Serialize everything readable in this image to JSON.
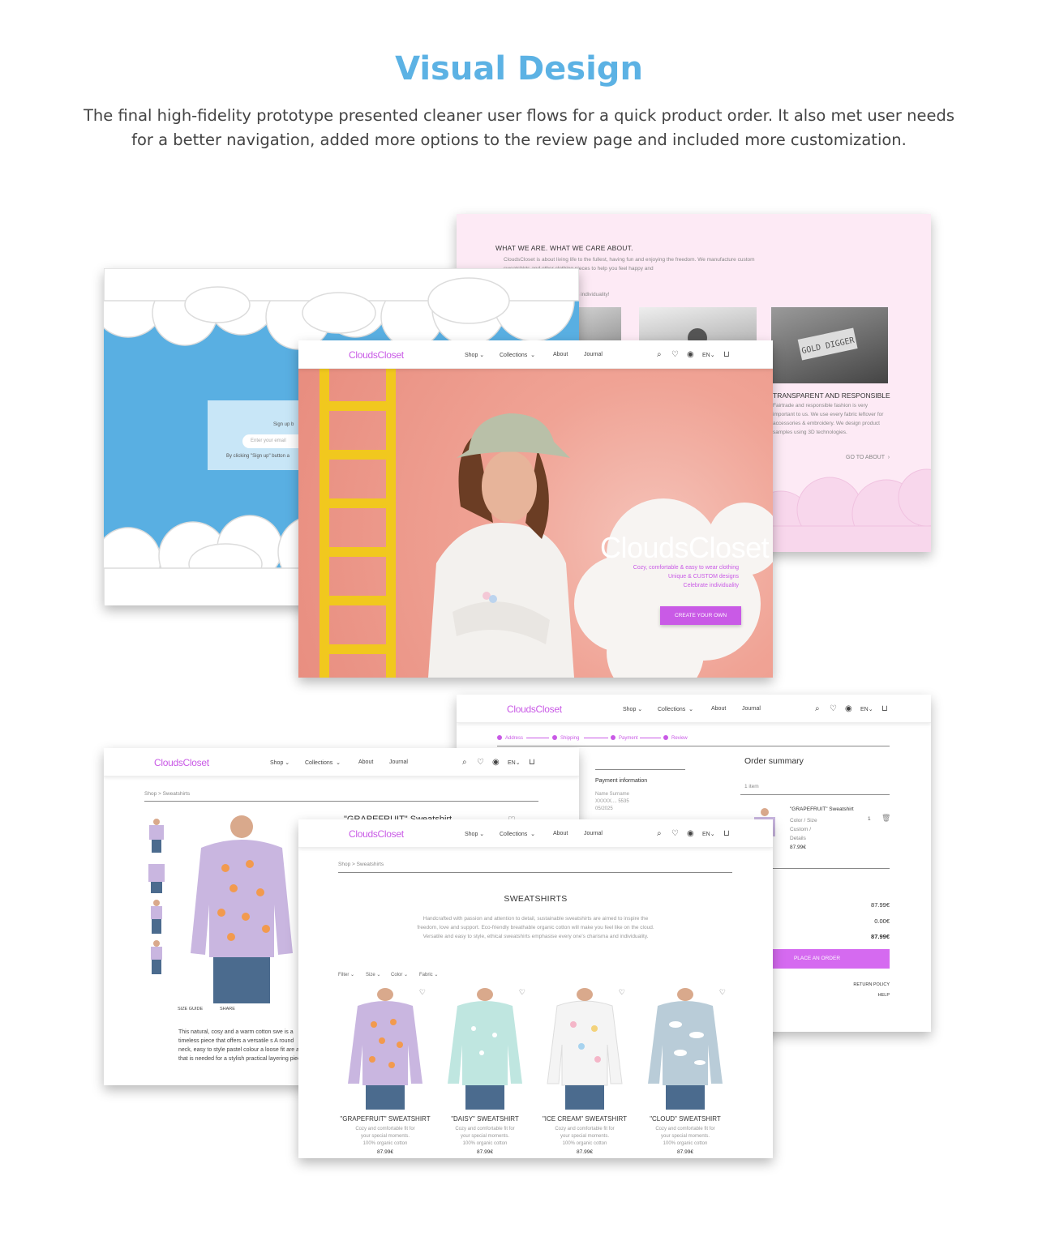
{
  "heading": "Visual Design",
  "intro": "The final high-fidelity prototype presented cleaner user flows for a quick product order. It also met user needs for a better navigation, added more options to the review page and included more customization.",
  "header": {
    "logo": "CloudsCloset",
    "nav": [
      "Shop",
      "Collections",
      "About",
      "Journal"
    ],
    "lang": "EN"
  },
  "about": {
    "title": "WHAT WE ARE.  WHAT WE CARE ABOUT.",
    "text1": "CloudsCloset is about living life to the fullest, having fun and enjoying the freedom. We manufacture custom sweatshirts and other clothing pieces to help you feel happy and",
    "text2": "support & celebrate each other's individuality!",
    "title2": "TRANSPARENT AND RESPONSIBLE",
    "text3": "Fairtrade and responsible fashion is very important to us. We use every fabric leftover for accessories & embroidery. We design product samples using 3D technologies.",
    "go": "GO TO ABOUT",
    "badge": "GOLD DIGGER"
  },
  "signup": {
    "prompt": "Sign up b",
    "placeholder": "Enter your email",
    "terms": "By clicking \"Sign up\" button a"
  },
  "hero": {
    "brand": "CloudsCloset",
    "tag1": "Cozy, comfortable & easy to wear clothing",
    "tag2": "Unique & CUSTOM designs",
    "tag3": "Celebrate individuality",
    "cta": "CREATE YOUR OWN"
  },
  "checkout": {
    "steps": [
      "Address",
      "Shipping",
      "Payment",
      "Review"
    ],
    "summary_title": "Order summary",
    "item_count": "1 item",
    "payment_title": "Payment information",
    "payment_lines": [
      "Name Surname",
      "XXXXX.... 5535",
      "05/2025"
    ],
    "product_name": "\"GRAPEFRUIT\" Sweatshirt",
    "product_opts": [
      "Color / Size",
      "Custom /",
      "Details"
    ],
    "product_price": "87.99€",
    "qty": "1",
    "subtotal": "87.99€",
    "shipping": "0.00€",
    "total": "87.99€",
    "place": "PLACE AN ORDER",
    "links": [
      "RETURN POLICY",
      "HELP"
    ]
  },
  "detail": {
    "crumb": "Shop > Sweatshirts",
    "title": "\"GRAPEFRUIT\" Sweatshirt",
    "size_guide": "SIZE GUIDE",
    "share": "SHARE",
    "desc": "This natural, cosy and a warm cotton swe is a timeless piece that offers a versatile s A round neck, easy to style pastel colour a loose fit are all that is needed for a stylish practical layering piece."
  },
  "listing": {
    "crumb": "Shop > Sweatshirts",
    "title": "SWEATSHIRTS",
    "intro": "Handcrafted with passion and attention to detail, sustainable sweatshirts are aimed to inspire the freedom, love and support. Eco-friendly breathable organic cotton will make you feel like on the cloud. Versatile and easy to style, ethical sweatshirts emphasise every one's charisma and individuality.",
    "filters": [
      "Filter",
      "Size",
      "Color",
      "Fabric"
    ],
    "products": [
      {
        "name": "\"GRAPEFRUIT\" SWEATSHIRT",
        "desc1": "Cozy and comfortable fit for",
        "desc2": "your special moments.",
        "desc3": "100% organic cotton",
        "price": "87.99€",
        "color": "#c9b6e0"
      },
      {
        "name": "\"DAISY\" SWEATSHIRT",
        "desc1": "Cozy and comfortable fit for",
        "desc2": "your special moments.",
        "desc3": "100% organic cotton",
        "price": "87.99€",
        "color": "#bfe6e0"
      },
      {
        "name": "\"ICE CREAM\" SWEATSHIRT",
        "desc1": "Cozy and comfortable fit for",
        "desc2": "your special moments.",
        "desc3": "100% organic cotton",
        "price": "87.99€",
        "color": "#f4f4f4"
      },
      {
        "name": "\"CLOUD\" SWEATSHIRT",
        "desc1": "Cozy and comfortable fit for",
        "desc2": "your special moments.",
        "desc3": "100% organic cotton",
        "price": "87.99€",
        "color": "#b9ccd8"
      }
    ]
  },
  "colors": {
    "heading": "#5cb2e4",
    "brand": "#c95ae6",
    "sky": "#59afe2",
    "pink_bg": "#fdeaf5",
    "hero_bg": "#f0a395"
  }
}
